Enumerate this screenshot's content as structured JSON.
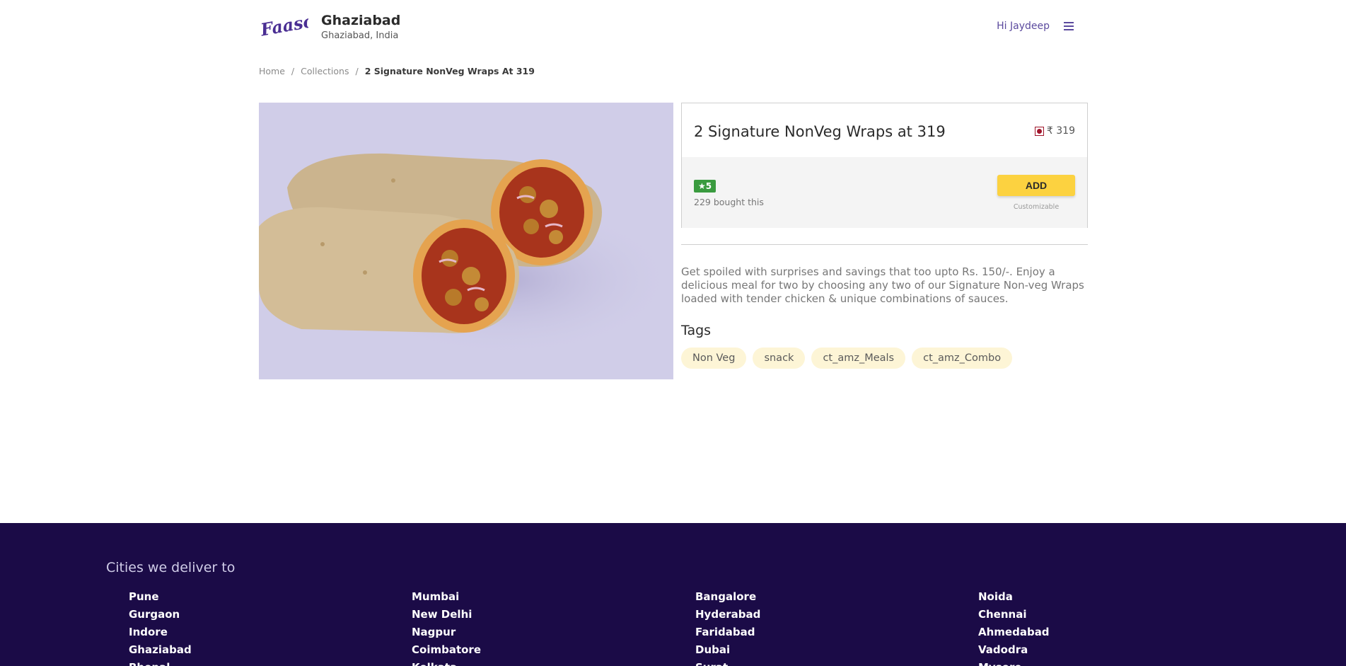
{
  "header": {
    "location_title": "Ghaziabad",
    "location_sub": "Ghaziabad, India",
    "greeting": "Hi Jaydeep",
    "brand_color": "#4a2e93"
  },
  "breadcrumb": {
    "items": [
      "Home",
      "Collections",
      "2 Signature NonVeg Wraps At 319"
    ],
    "separator": "/"
  },
  "product": {
    "title": "2 Signature NonVeg Wraps at 319",
    "price": "₹ 319",
    "rating": "★5",
    "bought": "229 bought this",
    "add_label": "ADD",
    "customizable": "Customizable",
    "description": "Get spoiled with surprises and savings that too upto Rs. 150/-. Enjoy a delicious meal for two by choosing any two of our Signature Non-veg Wraps loaded with tender chicken & unique combinations of sauces.",
    "tags_title": "Tags",
    "tags": [
      "Non Veg",
      "snack",
      "ct_amz_Meals",
      "ct_amz_Combo"
    ]
  },
  "footer": {
    "title": "Cities we deliver to",
    "columns": [
      [
        "Pune",
        "Gurgaon",
        "Indore",
        "Ghaziabad",
        "Bhopal"
      ],
      [
        "Mumbai",
        "New Delhi",
        "Nagpur",
        "Coimbatore",
        "Kolkata"
      ],
      [
        "Bangalore",
        "Hyderabad",
        "Faridabad",
        "Dubai",
        "Surat"
      ],
      [
        "Noida",
        "Chennai",
        "Ahmedabad",
        "Vadodra",
        "Mysore"
      ]
    ]
  }
}
